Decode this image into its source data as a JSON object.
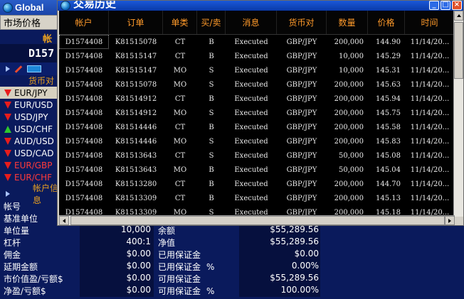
{
  "app": {
    "title": "Global"
  },
  "bg_tab": {
    "label": "市场价格"
  },
  "bg_header": {
    "label": "帐"
  },
  "bg_account": {
    "id": "D157"
  },
  "bg_colhdr": {
    "label": "货币对"
  },
  "pairs": [
    {
      "name": "EUR/JPY",
      "dir": "down",
      "selected": true,
      "red": false
    },
    {
      "name": "EUR/USD",
      "dir": "down",
      "selected": false,
      "red": false
    },
    {
      "name": "USD/JPY",
      "dir": "down",
      "selected": false,
      "red": false
    },
    {
      "name": "USD/CHF",
      "dir": "up",
      "selected": false,
      "red": false
    },
    {
      "name": "AUD/USD",
      "dir": "down",
      "selected": false,
      "red": false
    },
    {
      "name": "USD/CAD",
      "dir": "down",
      "selected": false,
      "red": false
    },
    {
      "name": "EUR/GBP",
      "dir": "down",
      "selected": false,
      "red": true
    },
    {
      "name": "EUR/CHF",
      "dir": "down",
      "selected": false,
      "red": true
    }
  ],
  "account_info": {
    "label": "帐户信息"
  },
  "account_rows": [
    {
      "label": "帐号",
      "value": "",
      "label2": "",
      "pct": "",
      "value2": ""
    },
    {
      "label": "基准单位",
      "value": "",
      "label2": "",
      "pct": "",
      "value2": ""
    },
    {
      "label": "单位量",
      "value": "10,000",
      "label2": "余额",
      "pct": "",
      "value2": "$55,289.56"
    },
    {
      "label": "杠杆",
      "value": "400:1",
      "label2": "净值",
      "pct": "",
      "value2": "$55,289.56"
    },
    {
      "label": "佣金",
      "value": "$0.00",
      "label2": "已用保证金",
      "pct": "",
      "value2": "$0.00"
    },
    {
      "label": "延期金额",
      "value": "$0.00",
      "label2": "已用保证金",
      "pct": "%",
      "value2": "0.00%"
    },
    {
      "label": "市价值盈/亏额$",
      "value": "$0.00",
      "label2": "可用保证金",
      "pct": "",
      "value2": "$55,289.56"
    },
    {
      "label": "净盈/亏额$",
      "value": "$0.00",
      "label2": "可用保证金",
      "pct": "%",
      "value2": "100.00%"
    }
  ],
  "window": {
    "title": "交易历史",
    "buttons": {
      "minimize": "_",
      "maximize": "□",
      "close": "×"
    }
  },
  "history": {
    "columns": [
      "帐户",
      "订单",
      "单类",
      "买/卖",
      "消息",
      "货币对",
      "数量",
      "价格",
      "时间"
    ],
    "rows": [
      [
        "D1574408",
        "K81515078",
        "CT",
        "B",
        "Executed",
        "GBP/JPY",
        "200,000",
        "144.90",
        "11/14/20..."
      ],
      [
        "D1574408",
        "K81515147",
        "CT",
        "B",
        "Executed",
        "GBP/JPY",
        "10,000",
        "145.29",
        "11/14/20..."
      ],
      [
        "D1574408",
        "K81515147",
        "MO",
        "S",
        "Executed",
        "GBP/JPY",
        "10,000",
        "145.31",
        "11/14/20..."
      ],
      [
        "D1574408",
        "K81515078",
        "MO",
        "S",
        "Executed",
        "GBP/JPY",
        "200,000",
        "145.63",
        "11/14/20..."
      ],
      [
        "D1574408",
        "K81514912",
        "CT",
        "B",
        "Executed",
        "GBP/JPY",
        "200,000",
        "145.94",
        "11/14/20..."
      ],
      [
        "D1574408",
        "K81514912",
        "MO",
        "S",
        "Executed",
        "GBP/JPY",
        "200,000",
        "145.75",
        "11/14/20..."
      ],
      [
        "D1574408",
        "K81514446",
        "CT",
        "B",
        "Executed",
        "GBP/JPY",
        "200,000",
        "145.58",
        "11/14/20..."
      ],
      [
        "D1574408",
        "K81514446",
        "MO",
        "S",
        "Executed",
        "GBP/JPY",
        "200,000",
        "145.83",
        "11/14/20..."
      ],
      [
        "D1574408",
        "K81513643",
        "CT",
        "S",
        "Executed",
        "GBP/JPY",
        "50,000",
        "145.08",
        "11/14/20..."
      ],
      [
        "D1574408",
        "K81513643",
        "MO",
        "B",
        "Executed",
        "GBP/JPY",
        "50,000",
        "145.04",
        "11/14/20..."
      ],
      [
        "D1574408",
        "K81513280",
        "CT",
        "B",
        "Executed",
        "GBP/JPY",
        "200,000",
        "144.70",
        "11/14/20..."
      ],
      [
        "D1574408",
        "K81513309",
        "CT",
        "B",
        "Executed",
        "GBP/JPY",
        "200,000",
        "145.13",
        "11/14/20..."
      ],
      [
        "D1574408",
        "K81513309",
        "MO",
        "S",
        "Executed",
        "GBP/JPY",
        "200,000",
        "145.18",
        "11/14/20..."
      ]
    ]
  },
  "colors": {
    "accent": "#ff9a2a",
    "background": "#0a1a5c",
    "grid": "#000000",
    "title_bar": "#1a58d8"
  }
}
